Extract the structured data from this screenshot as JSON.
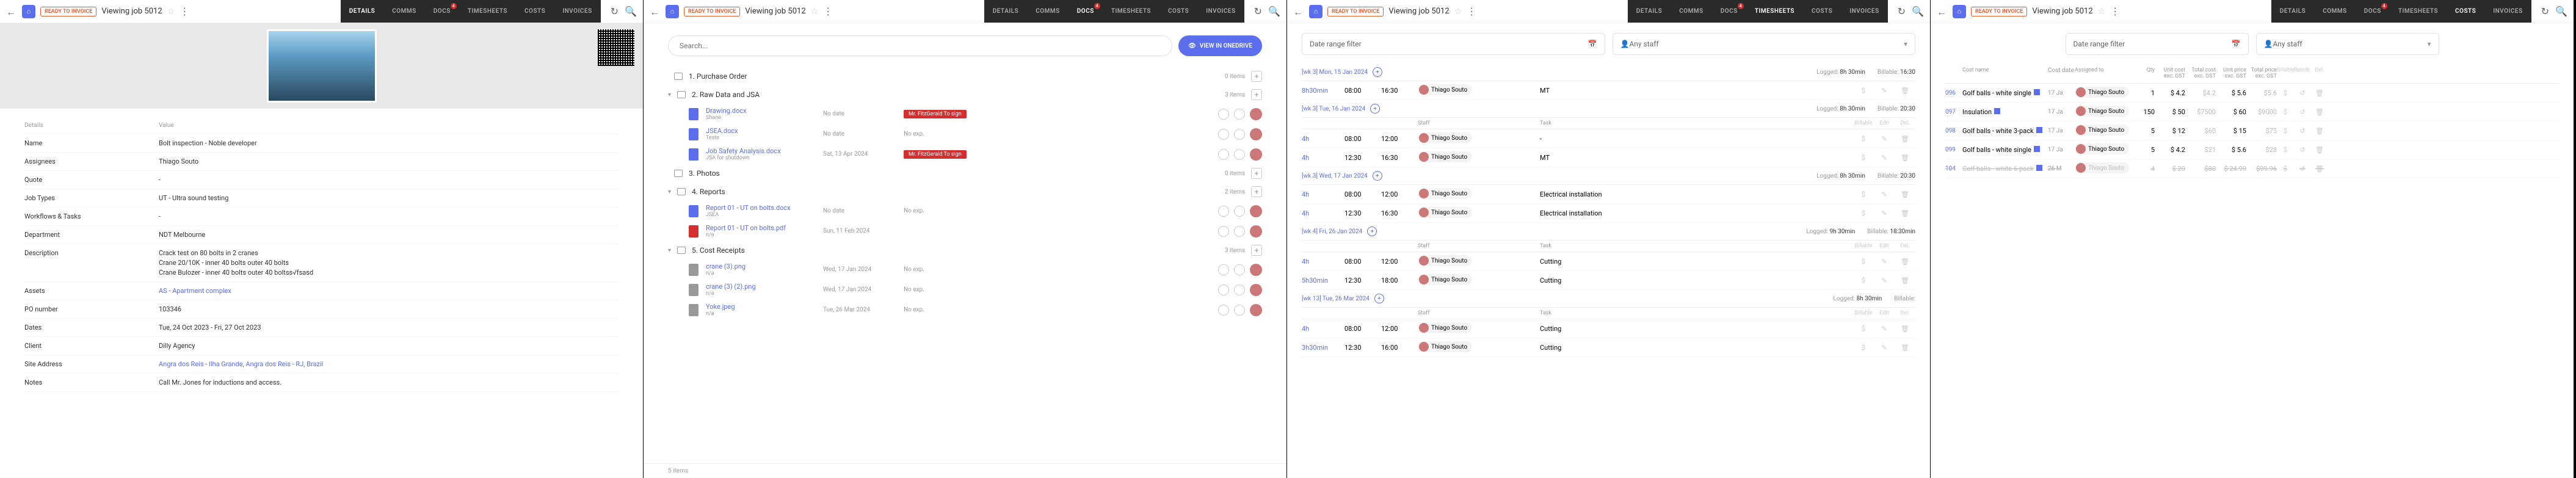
{
  "app": {
    "badge": "READY TO INVOICE",
    "title_prefix": "Viewing job",
    "job_id": "5012"
  },
  "tabs": {
    "details": "DETAILS",
    "comms": "COMMS",
    "docs": "DOCS",
    "timesheets": "TIMESHEETS",
    "costs": "COSTS",
    "invoices": "INVOICES",
    "docs_badge": "4"
  },
  "details": {
    "hdr_k": "Details",
    "hdr_v": "Value",
    "rows": [
      {
        "k": "Name",
        "v": "Bolt inspection - Noble developer"
      },
      {
        "k": "Assignees",
        "v": "Thiago Souto"
      },
      {
        "k": "Quote",
        "v": "-"
      },
      {
        "k": "Job Types",
        "v": "UT - Ultra sound testing"
      },
      {
        "k": "Workflows & Tasks",
        "v": "-"
      },
      {
        "k": "Department",
        "v": "NDT Melbourne"
      },
      {
        "k": "Description",
        "v": [
          "Crack test on 80 bolts in 2 cranes",
          "Crane 20/10K - inner 40 bolts outer 40 bolts",
          "Crane Bulozer - inner 40 bolts outer 40 boltss√fsasd"
        ]
      },
      {
        "k": "Assets",
        "v": "AS - Apartment complex",
        "link": true
      },
      {
        "k": "PO number",
        "v": "103346"
      },
      {
        "k": "Dates",
        "v": "Tue, 24 Oct 2023 - Fri, 27 Oct 2023"
      },
      {
        "k": "Client",
        "v": "Dilly Agency"
      },
      {
        "k": "Site Address",
        "v": "Angra dos Reis - Ilha Grande, Angra dos Reis - RJ, Brazil",
        "link": true
      },
      {
        "k": "Notes",
        "v": "Call Mr. Jones for inductions and access."
      }
    ]
  },
  "docs": {
    "search_ph": "Search...",
    "btn": "VIEW IN ONEDRIVE",
    "folders": [
      {
        "n": "1. Purchase Order",
        "m": "0 items"
      },
      {
        "n": "2. Raw Data and JSA",
        "m": "3 items",
        "open": true,
        "files": [
          {
            "fn": "Drawing.docx",
            "fs": "Shane",
            "c1": "No date",
            "c2": "",
            "red": "Mr. FitzGerald To sign",
            "t": "word"
          },
          {
            "fn": "JSEA.docx",
            "fs": "Teste",
            "c1": "No date",
            "c2": "No exp.",
            "t": "word"
          },
          {
            "fn": "Job Safety Analysis.docx",
            "fs": "JSA for shutdown",
            "c1": "Sat, 13 Apr 2024",
            "c2": "",
            "red": "Mr. FitzGerald To sign",
            "t": "word"
          }
        ]
      },
      {
        "n": "3. Photos",
        "m": "0 items"
      },
      {
        "n": "4. Reports",
        "m": "2 items",
        "open": true,
        "files": [
          {
            "fn": "Report 01 - UT on bolts.docx",
            "fs": "JSEA",
            "c1": "No date",
            "c2": "No exp.",
            "t": "word"
          },
          {
            "fn": "Report 01 - UT on bolts.pdf",
            "fs": "n/a",
            "c1": "Sun, 11 Feb 2024",
            "c2": "",
            "t": "pdf"
          }
        ]
      },
      {
        "n": "5. Cost Receipts",
        "m": "3 items",
        "open": true,
        "chev": true,
        "files": [
          {
            "fn": "crane (3).png",
            "fs": "n/a",
            "c1": "Wed, 17 Jan 2024",
            "c2": "No exp.",
            "t": "img"
          },
          {
            "fn": "crane (3) (2).png",
            "fs": "n/a",
            "c1": "Wed, 17 Jan 2024",
            "c2": "No exp.",
            "t": "img"
          },
          {
            "fn": "Yoke.jpeg",
            "fs": "n/a",
            "c1": "Tue, 26 Mar 2024",
            "c2": "No exp.",
            "t": "img"
          }
        ]
      }
    ],
    "foot": "5 items"
  },
  "timesheets": {
    "f1": "Date range filter",
    "f2": "Any staff",
    "col": {
      "staff": "Staff",
      "task": "Task",
      "bill": "Billable",
      "edit": "Edit",
      "del": "Del."
    },
    "days": [
      {
        "dt": "[wk 3] Mon, 15 Jan 2024",
        "logged": "8h 30min",
        "billable": "16:30",
        "rows": [
          {
            "d": "8h30min",
            "s": "08:00",
            "e": "16:30",
            "who": "Thiago Souto",
            "task": "MT"
          }
        ]
      },
      {
        "dt": "[wk 3] Tue, 16 Jan 2024",
        "logged": "8h 30min",
        "billable": "20:30",
        "col": true,
        "rows": [
          {
            "d": "4h",
            "s": "08:00",
            "e": "12:00",
            "who": "Thiago Souto",
            "task": "-"
          },
          {
            "d": "4h",
            "s": "12:30",
            "e": "16:30",
            "who": "Thiago Souto",
            "task": "MT"
          }
        ]
      },
      {
        "dt": "[wk 3] Wed, 17 Jan 2024",
        "logged": "8h 30min",
        "billable": "20:30",
        "rows": [
          {
            "d": "4h",
            "s": "08:00",
            "e": "12:00",
            "who": "Thiago Souto",
            "task": "Electrical installation"
          },
          {
            "d": "4h",
            "s": "12:30",
            "e": "16:30",
            "who": "Thiago Souto",
            "task": "Electrical installation"
          }
        ]
      },
      {
        "dt": "[wk 4] Fri, 26 Jan 2024",
        "logged": "9h 30min",
        "billable": "18:30min",
        "col": true,
        "rows": [
          {
            "d": "4h",
            "s": "08:00",
            "e": "12:00",
            "who": "Thiago Souto",
            "task": "Cutting"
          },
          {
            "d": "5h30min",
            "s": "12:30",
            "e": "18:00",
            "who": "Thiago Souto",
            "task": "Cutting"
          }
        ]
      },
      {
        "dt": "[wk 13] Tue, 26 Mar 2024",
        "logged": "8h 30min",
        "billable": "",
        "col": true,
        "rows": [
          {
            "d": "4h",
            "s": "08:00",
            "e": "12:00",
            "who": "Thiago Souto",
            "task": "Cutting"
          },
          {
            "d": "3h30min",
            "s": "12:30",
            "e": "16:00",
            "who": "Thiago Souto",
            "task": "Cutting"
          }
        ]
      }
    ]
  },
  "costs": {
    "f1": "Date range filter",
    "f2": "Any staff",
    "cols": {
      "name": "Cost name",
      "date": "Cost date",
      "assign": "Assigned to",
      "qty": "Qty",
      "uc": "Unit cost exc. GST",
      "tc": "Total cost exc. GST",
      "up": "Unit price exc. GST",
      "tp": "Total price exc. GST",
      "bill": "Billable",
      "remb": "Reimb.",
      "del": "Del."
    },
    "rows": [
      {
        "id": "096",
        "nm": "Golf balls - white single",
        "dt": "17 Ja",
        "who": "Thiago Souto",
        "q": "1",
        "uc": "$ 4.2",
        "tc": "$4.2",
        "up": "$ 5.6",
        "tp": "$5.6"
      },
      {
        "id": "097",
        "nm": "Insulation",
        "dt": "17 Ja",
        "who": "Thiago Souto",
        "q": "150",
        "uc": "$ 50",
        "tc": "$7500",
        "up": "$ 60",
        "tp": "$9000"
      },
      {
        "id": "098",
        "nm": "Golf balls - white 3-pack",
        "dt": "17 Ja",
        "who": "Thiago Souto",
        "q": "5",
        "uc": "$ 12",
        "tc": "$60",
        "up": "$ 15",
        "tp": "$75"
      },
      {
        "id": "099",
        "nm": "Golf balls - white single",
        "dt": "17 Ja",
        "who": "Thiago Souto",
        "q": "5",
        "uc": "$ 4.2",
        "tc": "$21",
        "up": "$ 5.6",
        "tp": "$28"
      },
      {
        "id": "104",
        "nm": "Golf balls - white 6-pack",
        "dt": "26 M",
        "who": "Thiago Souto",
        "q": "4",
        "uc": "$ 20",
        "tc": "$80",
        "up": "$ 24.99",
        "tp": "$99.96",
        "strike": true
      }
    ]
  }
}
